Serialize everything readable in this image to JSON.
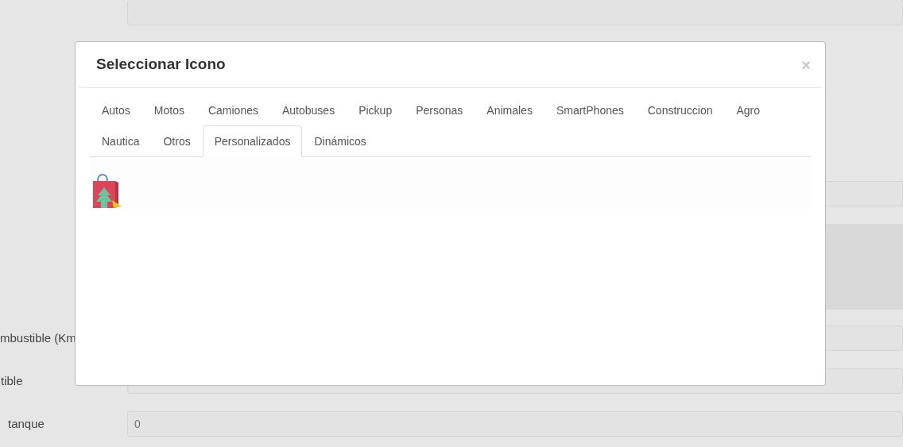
{
  "background_form": {
    "fields": [
      {
        "label": "mbustible (Km"
      },
      {
        "label": "tible"
      },
      {
        "label": "tanque",
        "value": "0"
      }
    ]
  },
  "modal": {
    "title": "Seleccionar Icono",
    "close": "×",
    "tabs": [
      {
        "label": "Autos",
        "selected": false
      },
      {
        "label": "Motos",
        "selected": false
      },
      {
        "label": "Camiones",
        "selected": false
      },
      {
        "label": "Autobuses",
        "selected": false
      },
      {
        "label": "Pickup",
        "selected": false
      },
      {
        "label": "Personas",
        "selected": false
      },
      {
        "label": "Animales",
        "selected": false
      },
      {
        "label": "SmartPhones",
        "selected": false
      },
      {
        "label": "Construccion",
        "selected": false
      },
      {
        "label": "Agro",
        "selected": false
      },
      {
        "label": "Nautica",
        "selected": false
      },
      {
        "label": "Otros",
        "selected": false
      },
      {
        "label": "Personalizados",
        "selected": true
      },
      {
        "label": "Dinámicos",
        "selected": false
      }
    ]
  }
}
